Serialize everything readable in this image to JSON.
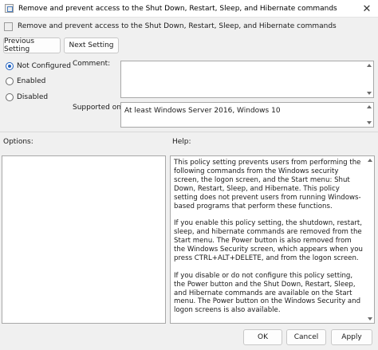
{
  "window": {
    "title": "Remove and prevent access to the Shut Down, Restart, Sleep, and Hibernate commands",
    "close_glyph": "✕"
  },
  "header": {
    "title": "Remove and prevent access to the Shut Down, Restart, Sleep, and Hibernate commands"
  },
  "nav": {
    "previous_label": "Previous Setting",
    "next_label": "Next Setting"
  },
  "state": {
    "options": [
      {
        "label": "Not Configured",
        "checked": true
      },
      {
        "label": "Enabled",
        "checked": false
      },
      {
        "label": "Disabled",
        "checked": false
      }
    ]
  },
  "comment": {
    "label": "Comment:",
    "value": ""
  },
  "supported": {
    "label": "Supported on:",
    "value": "At least Windows Server 2016, Windows 10"
  },
  "options_panel": {
    "label": "Options:"
  },
  "help_panel": {
    "label": "Help:",
    "paragraphs": [
      "This policy setting prevents users from performing the following commands from the Windows security screen, the logon screen, and the Start menu: Shut Down, Restart, Sleep, and Hibernate. This policy setting does not prevent users from running Windows-based programs that perform these functions.",
      "If you enable this policy setting, the shutdown, restart, sleep, and hibernate commands are removed from the Start menu. The Power button is also removed from the Windows Security screen, which appears when you press CTRL+ALT+DELETE, and from the logon screen.",
      "If you disable or do not configure this policy setting, the Power button and the Shut Down, Restart, Sleep, and Hibernate commands are available on the Start menu. The Power button on the Windows Security and logon screens is also available."
    ]
  },
  "footer": {
    "ok_label": "OK",
    "cancel_label": "Cancel",
    "apply_label": "Apply"
  },
  "colors": {
    "accent": "#1d5fbf",
    "background": "#f0f0f0"
  }
}
